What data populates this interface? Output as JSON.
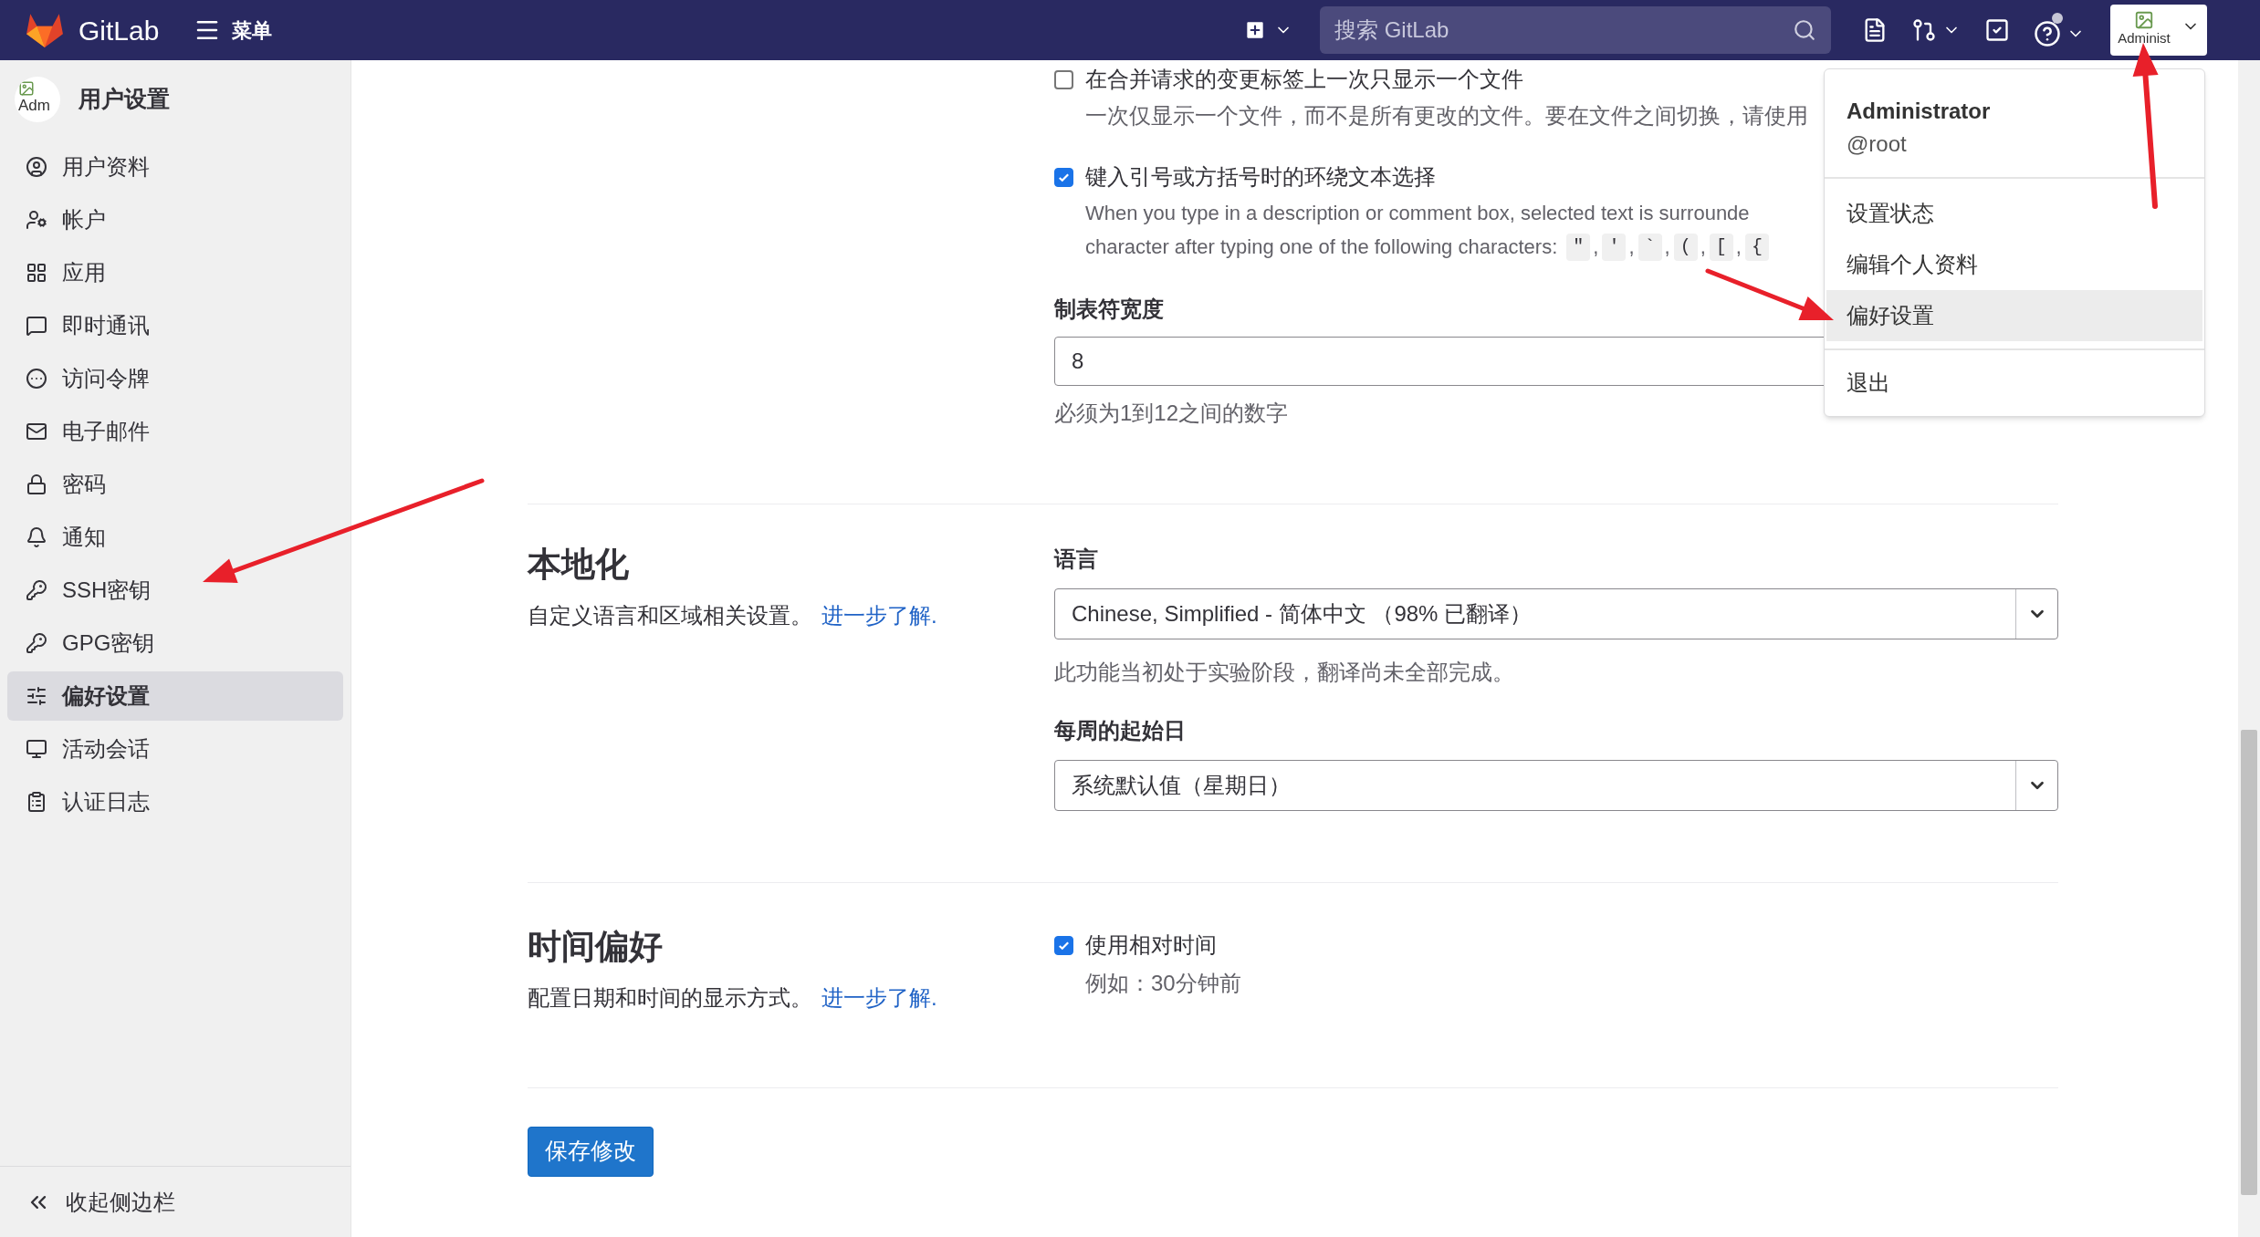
{
  "top_bar": {
    "brand": "GitLab",
    "menu_label": "菜单",
    "search": {
      "placeholder": "搜索 GitLab"
    },
    "avatar_alt": "Administ"
  },
  "sidebar": {
    "avatar_alt": "Adm",
    "title": "用户设置",
    "items": [
      {
        "label": "用户资料",
        "selected": false
      },
      {
        "label": "帐户",
        "selected": false
      },
      {
        "label": "应用",
        "selected": false
      },
      {
        "label": "即时通讯",
        "selected": false
      },
      {
        "label": "访问令牌",
        "selected": false
      },
      {
        "label": "电子邮件",
        "selected": false
      },
      {
        "label": "密码",
        "selected": false
      },
      {
        "label": "通知",
        "selected": false
      },
      {
        "label": "SSH密钥",
        "selected": false
      },
      {
        "label": "GPG密钥",
        "selected": false
      },
      {
        "label": "偏好设置",
        "selected": true
      },
      {
        "label": "活动会话",
        "selected": false
      },
      {
        "label": "认证日志",
        "selected": false
      }
    ],
    "collapse_label": "收起侧边栏"
  },
  "behavior_options": [
    {
      "label": "在合并请求的变更标签上一次只显示一个文件",
      "checked": false,
      "description": [
        "一次仅显示一个文件，而不是所有更改的文件。要在文件之间切换，请使用"
      ]
    },
    {
      "label": "键入引号或方括号时的环绕文本选择",
      "checked": true,
      "description": [
        "When you type in a description or comment box, selected text is surrounde",
        "character after typing one of the following characters:"
      ],
      "chars": [
        {
          "code": "\"",
          "separator": ","
        },
        {
          "code": "'",
          "separator": ","
        },
        {
          "code": "`",
          "separator": ","
        },
        {
          "code": "(",
          "separator": ","
        },
        {
          "code": "[",
          "separator": ","
        },
        {
          "code": "{"
        }
      ]
    }
  ],
  "tab_width": {
    "label": "制表符宽度",
    "value": "8",
    "help": "必须为1到12之间的数字"
  },
  "localization": {
    "title": "本地化",
    "description": "自定义语言和区域相关设置。",
    "link": "进一步了解.",
    "fields": [
      {
        "label": "语言",
        "value": "Chinese, Simplified - 简体中文 （98% 已翻译）",
        "help": "此功能当初处于实验阶段，翻译尚未全部完成。"
      },
      {
        "label": "每周的起始日",
        "value": "系统默认值（星期日）"
      }
    ]
  },
  "time_preferences": {
    "title": "时间偏好",
    "description": "配置日期和时间的显示方式。",
    "link": "进一步了解.",
    "option": {
      "label": "使用相对时间",
      "checked": true,
      "example": "例如：30分钟前"
    }
  },
  "save_button": "保存修改",
  "user_menu": {
    "name": "Administrator",
    "username": "@root",
    "items": [
      {
        "label": "设置状态",
        "selected": false,
        "divider_before": false
      },
      {
        "label": "编辑个人资料",
        "selected": false,
        "divider_before": false
      },
      {
        "label": "偏好设置",
        "selected": true,
        "divider_before": false
      },
      {
        "label": "退出",
        "selected": false,
        "divider_before": true
      }
    ]
  }
}
